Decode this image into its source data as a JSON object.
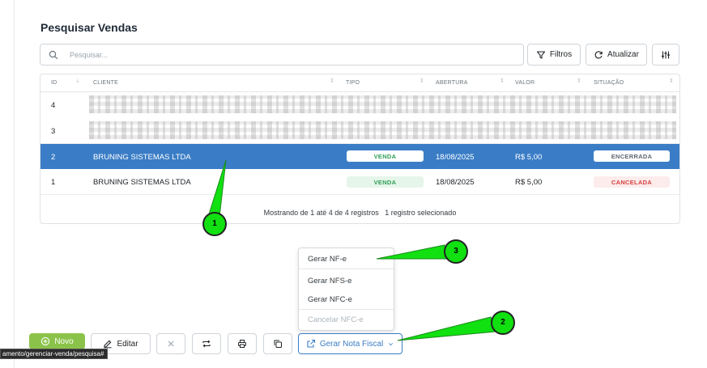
{
  "page": {
    "title": "Pesquisar Vendas"
  },
  "search": {
    "placeholder": "Pesquisar..."
  },
  "toolbar": {
    "filters_label": "Filtros",
    "refresh_label": "Atualizar"
  },
  "grid": {
    "columns": [
      "ID",
      "CLIENTE",
      "TIPO",
      "ABERTURA",
      "VALOR",
      "SITUAÇÃO"
    ],
    "rows": [
      {
        "id": "4",
        "cliente": "",
        "tipo": "",
        "abertura": "",
        "valor": "",
        "situacao": "",
        "obscured": true
      },
      {
        "id": "3",
        "cliente": "",
        "tipo": "",
        "abertura": "",
        "valor": "",
        "situacao": "",
        "obscured": true
      },
      {
        "id": "2",
        "cliente": "BRUNING SISTEMAS LTDA",
        "tipo": "VENDA",
        "abertura": "18/08/2025",
        "valor": "R$ 5,00",
        "situacao": "ENCERRADA",
        "selected": true
      },
      {
        "id": "1",
        "cliente": "BRUNING SISTEMAS LTDA",
        "tipo": "VENDA",
        "abertura": "18/08/2025",
        "valor": "R$ 5,00",
        "situacao": "CANCELADA"
      }
    ],
    "footer": "Mostrando de 1 até 4 de 4 registros",
    "selection_info": "1 registro selecionado"
  },
  "nf_menu": {
    "items": [
      {
        "label": "Gerar NF-e",
        "disabled": false
      },
      {
        "label": "Gerar NFS-e",
        "disabled": false
      },
      {
        "label": "Gerar NFC-e",
        "disabled": false
      },
      {
        "label": "Cancelar NFC-e",
        "disabled": true
      }
    ]
  },
  "actions": {
    "novo_label": "Novo",
    "editar_label": "Editar",
    "nota_fiscal_label": "Gerar Nota Fiscal"
  },
  "status_bar": {
    "url": "amento/gerenciar-venda/pesquisa#"
  },
  "callouts": [
    "1",
    "2",
    "3"
  ],
  "colors": {
    "selected_row": "#3a7dc6",
    "novo_button": "#8bc34a",
    "callout": "#11e011",
    "cancel_badge": "#d63e3e",
    "venda_badge": "#2f9e55"
  }
}
